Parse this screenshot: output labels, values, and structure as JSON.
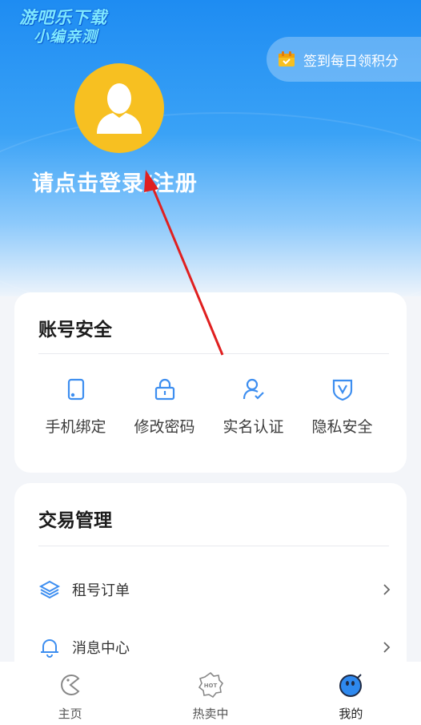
{
  "watermark": {
    "line1": "游吧乐下载",
    "line2": "小编亲测"
  },
  "header": {
    "signin_label": "签到每日领积分",
    "login_label": "请点击登录/注册"
  },
  "security": {
    "title": "账号安全",
    "items": [
      {
        "label": "手机绑定",
        "icon": "phone-icon"
      },
      {
        "label": "修改密码",
        "icon": "lock-icon"
      },
      {
        "label": "实名认证",
        "icon": "user-verify-icon"
      },
      {
        "label": "隐私安全",
        "icon": "shield-icon"
      }
    ]
  },
  "trade": {
    "title": "交易管理",
    "rows": [
      {
        "label": "租号订单",
        "icon": "layers-icon"
      },
      {
        "label": "消息中心",
        "icon": "bell-icon"
      }
    ]
  },
  "tabbar": {
    "tabs": [
      {
        "label": "主页",
        "icon": "home-icon"
      },
      {
        "label": "热卖中",
        "icon": "hot-icon",
        "badge": "HOT"
      },
      {
        "label": "我的",
        "icon": "profile-icon"
      }
    ]
  },
  "colors": {
    "accent": "#1e8cf2",
    "avatar_bg": "#f7c021",
    "annotation_arrow": "#e02020"
  }
}
